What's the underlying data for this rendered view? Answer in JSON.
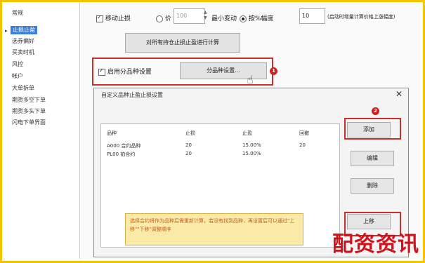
{
  "sidebar": {
    "items": [
      {
        "label": "常规"
      },
      {
        "label": "止损止盈"
      },
      {
        "label": "选券偏好"
      },
      {
        "label": "买卖时机"
      },
      {
        "label": "风控"
      },
      {
        "label": "帐户"
      },
      {
        "label": "大单拆单"
      },
      {
        "label": "期货多空下单"
      },
      {
        "label": "期货多头下单"
      },
      {
        "label": "闪电下单界面"
      }
    ],
    "active_index": 1
  },
  "top": {
    "cb1_label": "移动止损",
    "radio1_label": "价",
    "spin1_value": "100",
    "spin1_unit": "最小变动",
    "radio2_label": "按%幅度",
    "spin2_value": "10",
    "right_text": "(启动时增量计算价格上涨幅度)",
    "apply_button": "对所有持仓止损止盈进行计算"
  },
  "rule_row": {
    "checkbox_label": "启用分品种设置",
    "button_label": "分品种设置..."
  },
  "markers": {
    "m1": "1",
    "m2": "2"
  },
  "dialog": {
    "title": "自定义品种止盈止损设置",
    "close": "✕",
    "columns": [
      "品种",
      "止损",
      "止盈",
      "回撤"
    ],
    "rows": [
      [
        "A000 合约品种",
        "20",
        "15.00%",
        "20"
      ],
      [
        "PL00 铂合约",
        "20",
        "15.00%",
        ""
      ]
    ],
    "buttons": {
      "add": "添加",
      "edit": "编辑",
      "delete": "删除",
      "up": "上移"
    }
  },
  "tooltip": {
    "text": "选择合约将作为品种后需重新计算，若没有找到品种，再设置后可以通过\"上移\"\"下移\"调整顺序"
  },
  "watermark": "配资资讯",
  "colors": {
    "frame": "#f2c500",
    "highlight": "#c9302c",
    "selection": "#3d7fd6",
    "tooltip_bg": "#fbe9a8",
    "watermark": "#d1121a"
  }
}
